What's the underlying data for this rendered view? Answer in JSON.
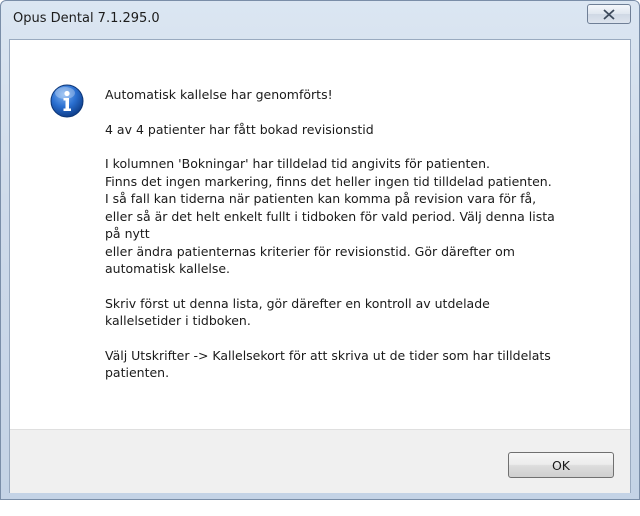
{
  "window": {
    "title": "Opus Dental 7.1.295.0",
    "close_icon": "close-icon"
  },
  "dialog": {
    "icon": "info-icon",
    "heading": "Automatisk kallelse har genomförts!",
    "summary": "4 av 4 patienter har fått bokad revisionstid",
    "paragraph1_lines": [
      "I kolumnen 'Bokningar' har tilldelad tid angivits för patienten.",
      "Finns det ingen markering, finns det heller ingen tid tilldelad patienten.",
      "I så fall kan tiderna när patienten kan komma på revision vara för få,",
      "eller så är det helt enkelt fullt i tidboken för vald period. Välj denna lista",
      "på nytt",
      "eller ändra patienternas kriterier för revisionstid. Gör därefter om",
      "automatisk kallelse."
    ],
    "paragraph2_lines": [
      "Skriv först ut denna lista, gör därefter en kontroll av utdelade",
      "kallelsetider i tidboken."
    ],
    "paragraph3_lines": [
      "Välj Utskrifter -> Kallelsekort för att skriva ut de tider som har tilldelats",
      "patienten."
    ]
  },
  "footer": {
    "ok_label": "OK"
  },
  "colors": {
    "accent": "#1e5fb8",
    "frame": "#c4d3e6"
  }
}
